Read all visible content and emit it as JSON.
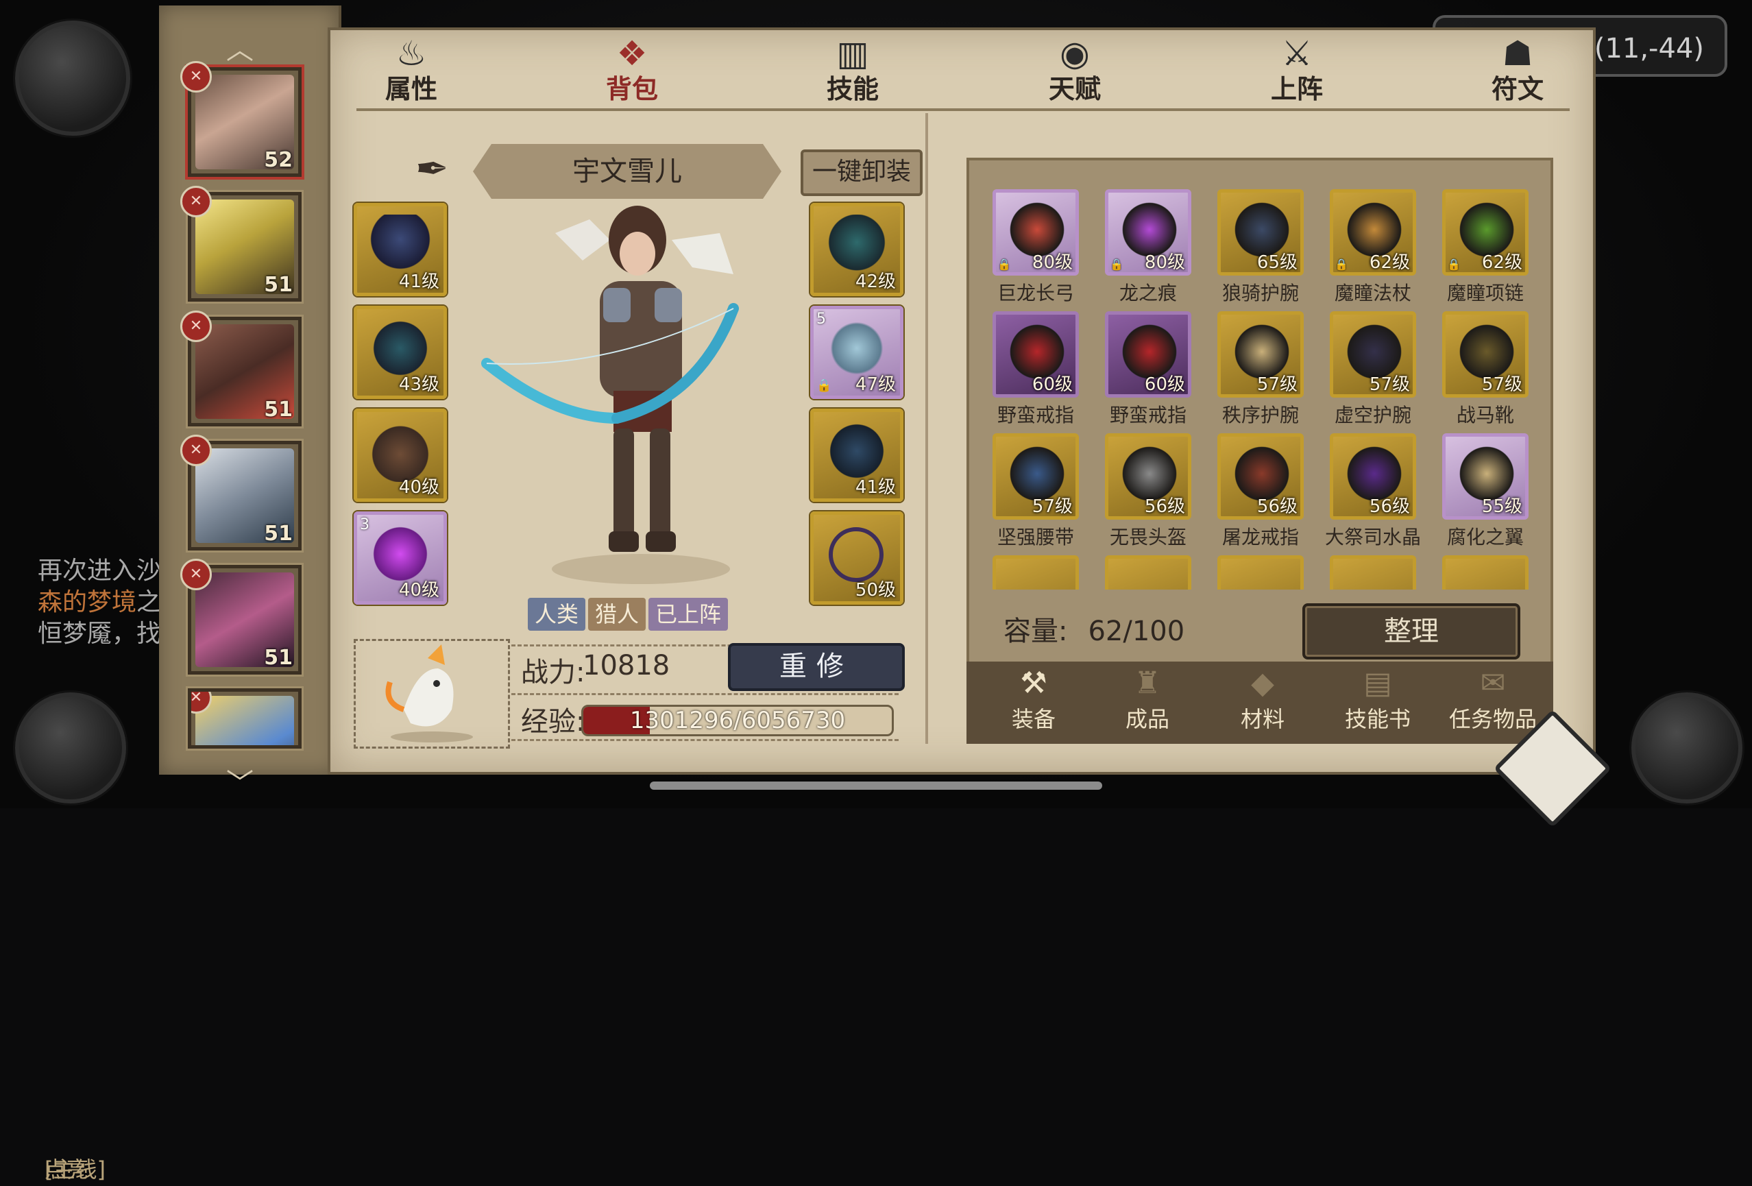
{
  "location": {
    "coords": "境(11,-44)"
  },
  "quest": {
    "tag": "[主线]",
    "title": "点亮",
    "line1": "再次进入沙",
    "line2": "森的梦境",
    "line2b": "之",
    "line3": "恒梦魇，找"
  },
  "heroes": [
    {
      "level": "52",
      "selected": true
    },
    {
      "level": "51"
    },
    {
      "level": "51"
    },
    {
      "level": "51"
    },
    {
      "level": "51"
    },
    {
      "level": ""
    }
  ],
  "tabs": [
    {
      "label": "属性",
      "icon": "flame-icon"
    },
    {
      "label": "背包",
      "icon": "bag-icon",
      "active": true
    },
    {
      "label": "技能",
      "icon": "book-icon"
    },
    {
      "label": "天赋",
      "icon": "eye-icon"
    },
    {
      "label": "上阵",
      "icon": "swords-icon"
    },
    {
      "label": "符文",
      "icon": "rune-icon"
    }
  ],
  "character": {
    "name": "宇文雪儿",
    "unequip_label": "一键卸装",
    "tags": [
      "人类",
      "猎人",
      "已上阵"
    ],
    "power_label": "战力:",
    "power": "10818",
    "repair_label": "重修",
    "exp_label": "经验:",
    "exp_text": "1301296/6056730",
    "exp_fraction": 0.215
  },
  "equipped_left": [
    {
      "level": "41级",
      "icon": "helmet-icon"
    },
    {
      "level": "43级",
      "icon": "armor-icon"
    },
    {
      "level": "40级",
      "icon": "boots-icon"
    },
    {
      "level": "40级",
      "icon": "purple-glove-icon",
      "count": "3",
      "rarity": "purple"
    }
  ],
  "equipped_right": [
    {
      "level": "42级",
      "icon": "shoulder-icon"
    },
    {
      "level": "47级",
      "icon": "bow-icon",
      "rarity": "purple",
      "locked": true,
      "count": "5"
    },
    {
      "level": "41级",
      "icon": "bracer-icon"
    },
    {
      "level": "50级",
      "icon": "necklace-icon"
    }
  ],
  "inventory": {
    "capacity_label": "容量:",
    "capacity": "62/100",
    "sort_label": "整理",
    "items": [
      {
        "name": "巨龙长弓",
        "level": "80级",
        "rarity": "purple",
        "locked": true
      },
      {
        "name": "龙之痕",
        "level": "80级",
        "rarity": "purple",
        "locked": true
      },
      {
        "name": "狼骑护腕",
        "level": "65级",
        "rarity": "gold"
      },
      {
        "name": "魔瞳法杖",
        "level": "62级",
        "rarity": "gold",
        "locked": true
      },
      {
        "name": "魔瞳项链",
        "level": "62级",
        "rarity": "gold",
        "locked": true
      },
      {
        "name": "野蛮戒指",
        "level": "60级",
        "rarity": "mpurple"
      },
      {
        "name": "野蛮戒指",
        "level": "60级",
        "rarity": "mpurple"
      },
      {
        "name": "秩序护腕",
        "level": "57级",
        "rarity": "gold"
      },
      {
        "name": "虚空护腕",
        "level": "57级",
        "rarity": "gold"
      },
      {
        "name": "战马靴",
        "level": "57级",
        "rarity": "gold"
      },
      {
        "name": "坚强腰带",
        "level": "57级",
        "rarity": "gold"
      },
      {
        "name": "无畏头盔",
        "level": "56级",
        "rarity": "gold"
      },
      {
        "name": "屠龙戒指",
        "level": "56级",
        "rarity": "gold"
      },
      {
        "name": "大祭司水晶",
        "level": "56级",
        "rarity": "gold"
      },
      {
        "name": "腐化之翼",
        "level": "55级",
        "rarity": "purple"
      }
    ]
  },
  "bottom_tabs": [
    {
      "label": "装备",
      "icon": "equipment-icon",
      "active": true
    },
    {
      "label": "成品",
      "icon": "pouch-icon"
    },
    {
      "label": "材料",
      "icon": "ore-icon"
    },
    {
      "label": "技能书",
      "icon": "scroll-icon"
    },
    {
      "label": "任务物品",
      "icon": "quest-item-icon"
    }
  ]
}
